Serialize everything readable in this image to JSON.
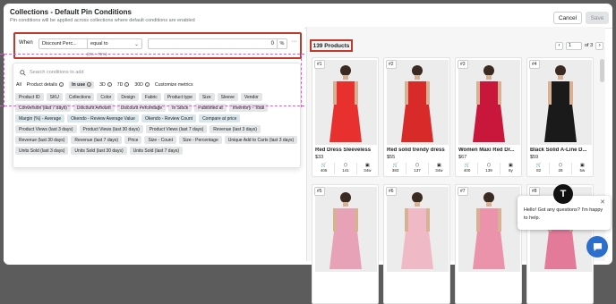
{
  "header": {
    "title": "Collections - Default Pin Conditions",
    "subtitle": "Pin conditions will be applied across collections where default conditions are enabled",
    "cancel_label": "Cancel",
    "save_label": "Save"
  },
  "condition": {
    "when_label": "When",
    "field": "Discount Perc...",
    "operator": "equal to",
    "value": "0",
    "unit": "%",
    "hint": "(0% - 75%)"
  },
  "dropdown": {
    "search_placeholder": "Search conditions to add",
    "tabs": [
      {
        "label": "All"
      },
      {
        "label": "Product details"
      },
      {
        "label": "In use"
      },
      {
        "label": "3D"
      },
      {
        "label": "7D"
      },
      {
        "label": "30D"
      },
      {
        "label": "Customize metrics"
      }
    ],
    "chips": [
      "Product ID",
      "SKU",
      "Collections",
      "Color",
      "Design",
      "Fabric",
      "Product type",
      "Size",
      "Sleeve",
      "Vendor",
      "Conversion (last 7 days)",
      "Discount Amount",
      "Discount Percentage",
      "In Stock",
      "Published at",
      "Inventory - Total",
      "Margin (%) - Average",
      "Okendo - Review Average Value",
      "Okendo - Review Count",
      "Compare at price",
      "Product Views (last 3 days)",
      "Product Views (last 30 days)",
      "Product Views (last 7 days)",
      "Revenue (last 3 days)",
      "Revenue (last 30 days)",
      "Revenue (last 7 days)",
      "Price",
      "Size - Count",
      "Size - Percentage",
      "Unique Add to Carts (last 3 days)",
      "Units Sold (last 3 days)",
      "Units Sold (last 30 days)",
      "Units Sold (last 7 days)"
    ]
  },
  "products": {
    "count_label": "139 Products",
    "page": "1",
    "of_label": "of 3",
    "cards": [
      {
        "num": "#1",
        "name": "Red Dress Sleeveless",
        "price": "$33",
        "stats": [
          "405",
          "141",
          "34w"
        ],
        "color": "#e8312f"
      },
      {
        "num": "#2",
        "name": "Red solid trendy dress",
        "price": "$55",
        "stats": [
          "383",
          "137",
          "34w"
        ],
        "color": "#d92a2a"
      },
      {
        "num": "#3",
        "name": "Women Maxi Red Dr...",
        "price": "$67",
        "stats": [
          "400",
          "139",
          "6y"
        ],
        "color": "#c8173a"
      },
      {
        "num": "#4",
        "name": "Black Solid A-Line D...",
        "price": "$59",
        "stats": [
          "82",
          "28",
          "5w"
        ],
        "color": "#1a1a1a"
      },
      {
        "num": "#5",
        "name": "",
        "price": "",
        "stats": [],
        "color": "#e8a2b8"
      },
      {
        "num": "#6",
        "name": "",
        "price": "",
        "stats": [],
        "color": "#f0b9c6"
      },
      {
        "num": "#7",
        "name": "",
        "price": "",
        "stats": [],
        "color": "#ea93ab"
      },
      {
        "num": "#8",
        "name": "",
        "price": "",
        "stats": [],
        "color": "#e47a9a"
      }
    ]
  },
  "chat": {
    "message": "Hello! Got any questions? I'm happy to help.",
    "avatar_letter": "T"
  }
}
